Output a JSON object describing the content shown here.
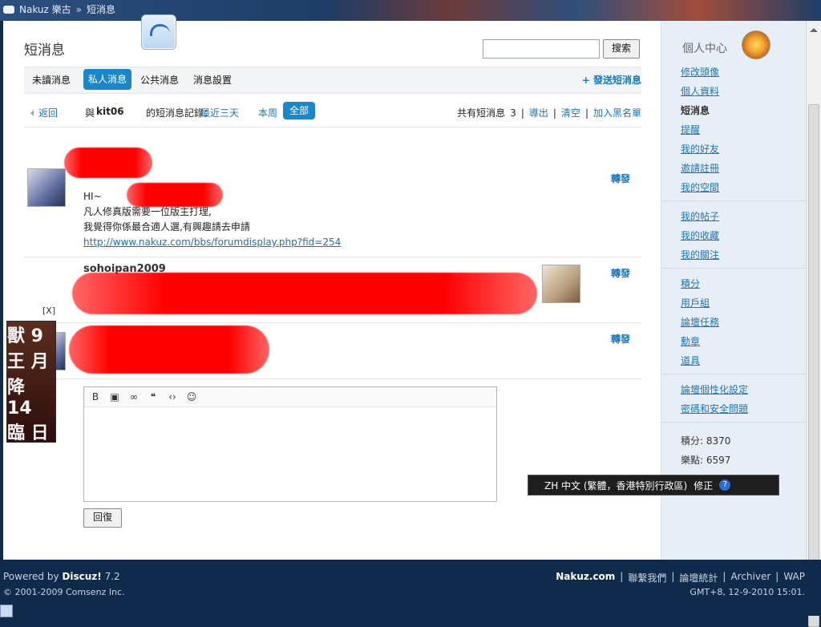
{
  "topbar": {
    "breadcrumb": [
      "Nakuz 樂古",
      "»",
      "短消息"
    ]
  },
  "header": {
    "title": "短消息",
    "search_placeholder": "",
    "search_button": "搜索"
  },
  "tabs": {
    "items": [
      "未讀消息",
      "私人消息",
      "公共消息",
      "消息設置"
    ],
    "active_index": 1,
    "compose_label": "+ 發送短消息"
  },
  "record": {
    "back": "返回",
    "with_prefix": "與",
    "user": "kit06",
    "records_label": "的短消息記錄：",
    "ranges": [
      "最近三天",
      "本周",
      "全部"
    ],
    "summary": "共有短消息",
    "count": "3",
    "actions": [
      "導出",
      "清空",
      "加入黑名單"
    ]
  },
  "messages": [
    {
      "sender": "kit06",
      "lines": [
        "HI~",
        "凡人修真版需要一位版主打理,",
        "我覺得你係最合適人選,有興趣請去申請"
      ],
      "link": "http://www.nakuz.com/bbs/forumdisplay.php?fid=254",
      "forward": "轉發"
    },
    {
      "sender": "sohoipan2009",
      "forward": "轉發"
    },
    {
      "sender": "",
      "forward": "轉發"
    }
  ],
  "ad": {
    "close": "[X]",
    "text": [
      "獸 9",
      "王 月",
      "降 14",
      "臨 日"
    ]
  },
  "editor": {
    "tools": [
      "B",
      "image-icon",
      "link-icon",
      "quote-icon",
      "code-icon",
      "smile-icon"
    ],
    "reply_button": "回復"
  },
  "ime": {
    "text": "ZH 中文 (繁體，香港特別行政區)",
    "correction": "修正",
    "help": "?"
  },
  "sidebar": {
    "title": "個人中心",
    "groups": [
      [
        "修改頭像",
        "個人資料",
        "短消息",
        "提醒",
        "我的好友",
        "邀請註冊",
        "我的空間"
      ],
      [
        "我的帖子",
        "我的收藏",
        "我的關注"
      ],
      [
        "積分",
        "用戶組",
        "論壇任務",
        "勳章",
        "道具"
      ],
      [
        "論壇個性化設定",
        "密碼和安全問題"
      ]
    ],
    "current": "短消息",
    "stats": {
      "points": "積分: 8370",
      "fun": "樂點: 6597"
    }
  },
  "footer": {
    "powered": "Powered by",
    "brand": "Discuz!",
    "version": "7.2",
    "copyright": "© 2001-2009 Comsenz Inc.",
    "site": "Nakuz.com",
    "links": [
      "聯繫我們",
      "論壇統計",
      "Archiver",
      "WAP"
    ],
    "time": "GMT+8, 12-9-2010 15:01."
  }
}
